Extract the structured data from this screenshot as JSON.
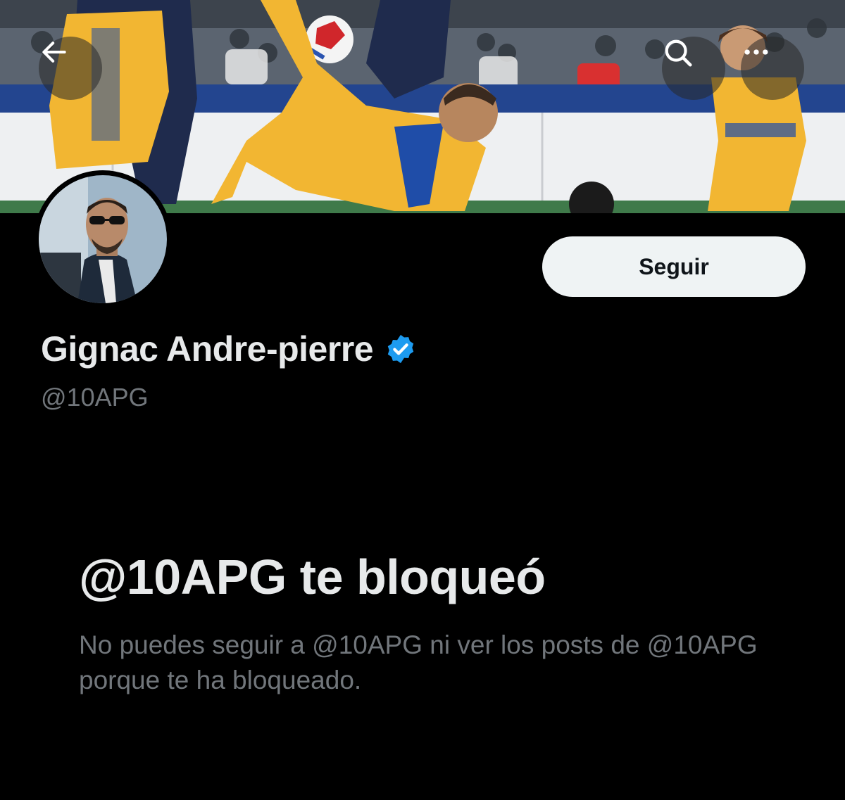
{
  "header": {
    "back_icon": "arrow-left-icon",
    "search_icon": "search-icon",
    "more_icon": "more-horizontal-icon"
  },
  "profile": {
    "display_name": "Gignac Andre-pierre",
    "handle": "@10APG",
    "verified_icon": "verified-badge-icon",
    "verified_color": "#1d9bf0",
    "follow_label": "Seguir"
  },
  "blocked": {
    "title": "@10APG te bloqueó",
    "description": "No puedes seguir a @10APG ni ver los posts de @10APG porque te ha bloqueado."
  },
  "colors": {
    "background": "#000000",
    "primary_text": "#e7e9ea",
    "secondary_text": "#71767b",
    "button_bg": "#eff3f4",
    "jersey_yellow": "#f2b632",
    "jersey_navy": "#1f2b4d"
  }
}
